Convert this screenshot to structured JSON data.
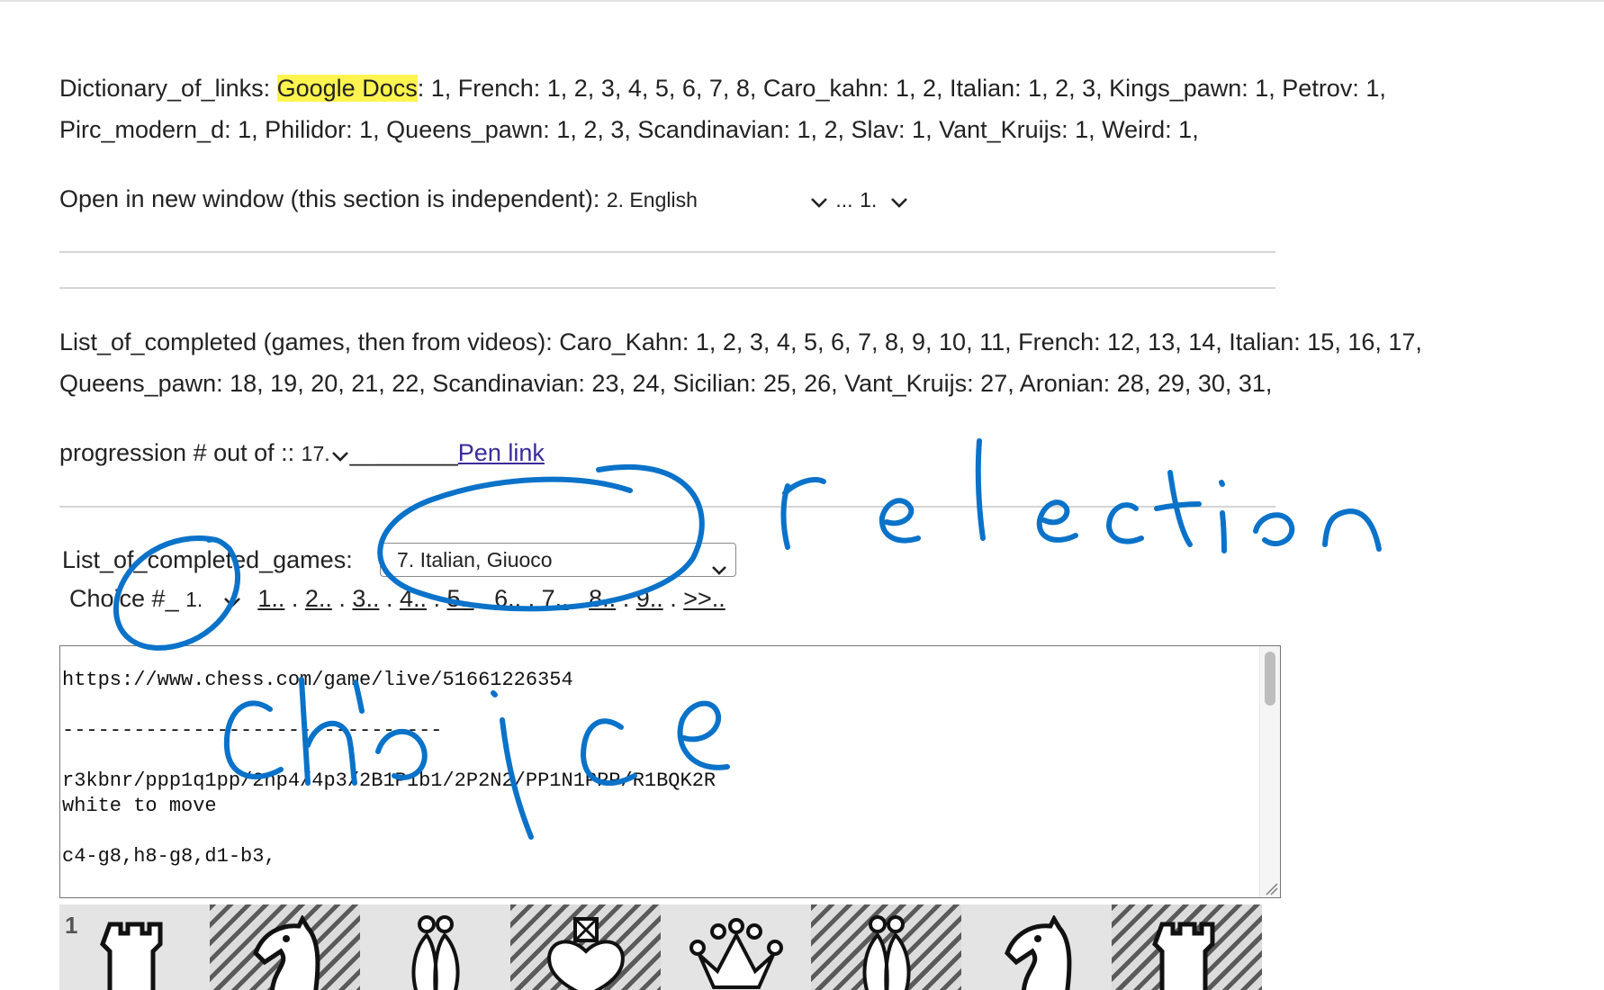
{
  "dictionary": {
    "label": "Dictionary_of_links:",
    "highlight": "Google Docs",
    "line1_rest": ": 1, French: 1, 2, 3, 4, 5, 6, 7, 8, Caro_kahn: 1, 2, Italian: 1, 2, 3, Kings_pawn: 1, Petrov: 1,",
    "line2": "Pirc_modern_d: 1, Philidor: 1, Queens_pawn: 1, 2, 3, Scandinavian: 1, 2, Slav: 1, Vant_Kruijs: 1, Weird: 1,"
  },
  "open_window": {
    "label": "Open in new window (this section is independent):",
    "select1_value": "2. English",
    "ellipsis": "...",
    "select2_value": "1."
  },
  "completed": {
    "line1": "List_of_completed (games, then from videos): Caro_Kahn: 1, 2, 3, 4, 5, 6, 7, 8, 9, 10, 11, French: 12, 13, 14, Italian: 15, 16, 17,",
    "line2": "Queens_pawn: 18, 19, 20, 21, 22, Scandinavian: 23, 24, Sicilian: 25, 26, Vant_Kruijs: 27, Aronian: 28, 29, 30, 31,"
  },
  "progression": {
    "label": "progression # out of ::",
    "select_value": "17.",
    "blank": "________",
    "link_text": "Pen  link"
  },
  "games": {
    "label": "List_of_completed_games:",
    "select_value": "7. Italian, Giuoco"
  },
  "choice": {
    "label": "Choice #_",
    "select_value": "1.",
    "pages": [
      "1..",
      "2..",
      "3..",
      "4..",
      "5..",
      "6..",
      "7..",
      "8..",
      "9..",
      ">>.."
    ],
    "separator": " . "
  },
  "textarea": {
    "url": "https://www.chess.com/game/live/51661226354",
    "dashes": "--------------------------------",
    "fen": "r3kbnr/ppp1q1pp/2np4/4p3/2B1P1b1/2P2N2/PP1N1PPP/R1BQK2R",
    "to_move": "white to move",
    "moves": "c4-g8,h8-g8,d1-b3,"
  },
  "board": {
    "rank_label": "1",
    "pieces": [
      "rook",
      "knight",
      "bishop",
      "king",
      "queen",
      "bishop",
      "knight",
      "rook"
    ]
  },
  "annotations": {
    "word1": "selection",
    "word2": "choice",
    "ink_color": "#0a72c9"
  },
  "colors": {
    "highlight": "#fff44f",
    "link": "#3a2a9a",
    "rule": "#d5d5d5"
  }
}
